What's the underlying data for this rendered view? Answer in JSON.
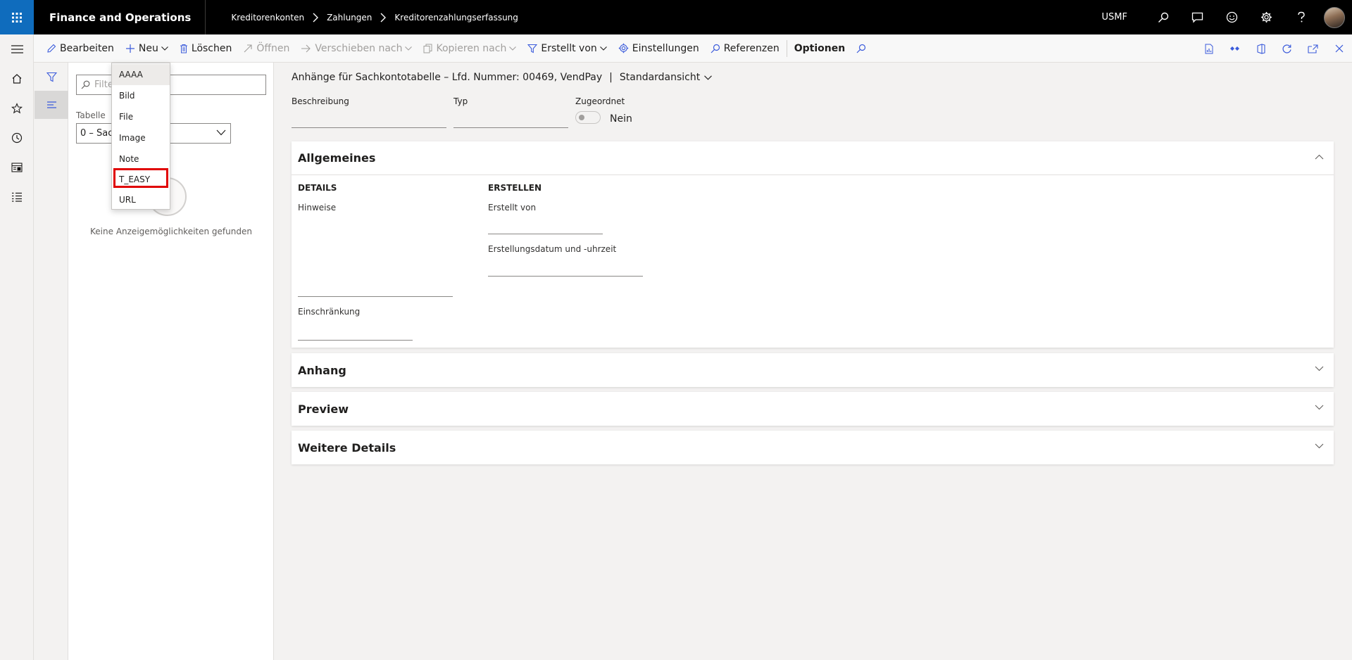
{
  "topbar": {
    "app_title": "Finance and Operations",
    "breadcrumb": [
      "Kreditorenkonten",
      "Zahlungen",
      "Kreditorenzahlungserfassung"
    ],
    "company": "USMF"
  },
  "actions": {
    "edit": "Bearbeiten",
    "new": "Neu",
    "delete": "Löschen",
    "open": "Öffnen",
    "move_to": "Verschieben nach",
    "copy_to": "Kopieren nach",
    "created_by": "Erstellt von",
    "settings": "Einstellungen",
    "references": "Referenzen",
    "options": "Optionen"
  },
  "new_menu": {
    "items": [
      "AAAA",
      "Bild",
      "File",
      "Image",
      "Note",
      "T_EASY",
      "URL"
    ],
    "hovered": "AAAA",
    "highlighted": "T_EASY"
  },
  "list_pane": {
    "filter_placeholder": "Filter",
    "table_label": "Tabelle",
    "table_value": "0 – Sac",
    "empty_text": "Keine Anzeigemöglichkeiten gefunden"
  },
  "main": {
    "page_title": "Anhänge für Sachkontotabelle – Lfd. Nummer: 00469, VendPay",
    "separator": "|",
    "view_name": "Standardansicht",
    "fields": {
      "description_label": "Beschreibung",
      "type_label": "Typ",
      "assigned_label": "Zugeordnet",
      "assigned_value": "Nein"
    },
    "general": {
      "title": "Allgemeines",
      "details_group": "DETAILS",
      "notes_label": "Hinweise",
      "restriction_label": "Einschränkung",
      "create_group": "ERSTELLEN",
      "created_by_label": "Erstellt von",
      "created_datetime_label": "Erstellungsdatum und -uhrzeit"
    },
    "sections": [
      "Anhang",
      "Preview",
      "Weitere Details"
    ]
  },
  "colors": {
    "topbar": "#000000",
    "waffle_accent": "#0f6cbd",
    "icon_blue": "#3b5bdb",
    "highlight_red": "#e00000"
  }
}
